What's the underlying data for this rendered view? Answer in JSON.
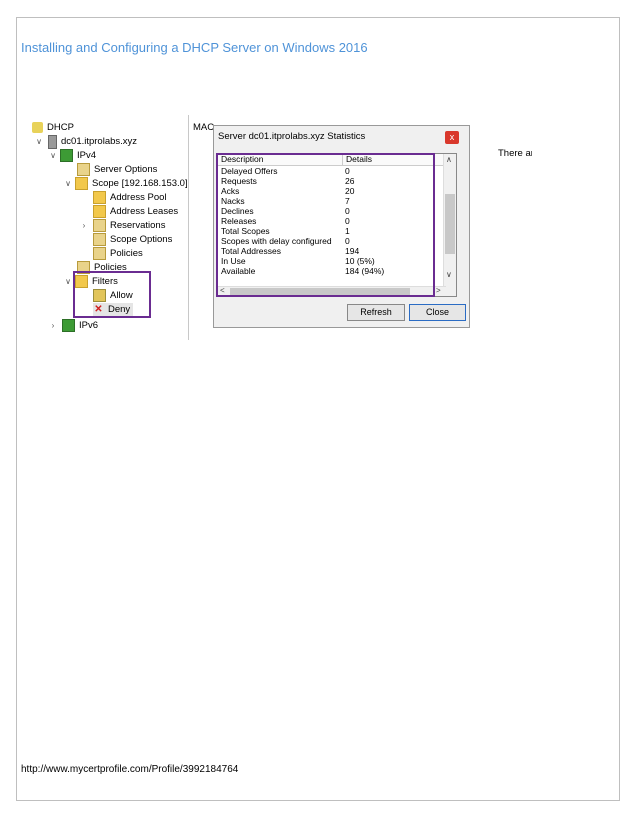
{
  "doc_title": "Installing and Configuring a DHCP Server on Windows 2016",
  "footer_url": "http://www.mycertprofile.com/Profile/3992184764",
  "tree": [
    {
      "label": "DHCP",
      "icon": "dhcp-icon"
    },
    {
      "label": "dc01.itprolabs.xyz",
      "icon": "server-icon"
    },
    {
      "label": "IPv4",
      "icon": "ipv4-icon"
    },
    {
      "label": "Server Options",
      "icon": "server-options-icon"
    },
    {
      "label": "Scope [192.168.153.0]",
      "icon": "folder-icon"
    },
    {
      "label": "Address Pool",
      "icon": "address-pool-icon"
    },
    {
      "label": "Address Leases",
      "icon": "address-leases-icon"
    },
    {
      "label": "Reservations",
      "icon": "reservations-icon"
    },
    {
      "label": "Scope Options",
      "icon": "scope-options-icon"
    },
    {
      "label": "Policies",
      "icon": "policies-icon"
    },
    {
      "label": "Policies",
      "icon": "policies-icon"
    },
    {
      "label": "Filters",
      "icon": "filters-icon"
    },
    {
      "label": "Allow",
      "icon": "allow-icon"
    },
    {
      "label": "Deny",
      "icon": "deny-icon"
    },
    {
      "label": "IPv6",
      "icon": "ipv6-icon"
    }
  ],
  "right_pane": {
    "column_label": "MAC",
    "empty_text": "There are no items"
  },
  "dialog": {
    "title": "Server dc01.itprolabs.xyz Statistics",
    "close_glyph": "x",
    "columns": [
      "Description",
      "Details"
    ],
    "rows": [
      [
        "Delayed Offers",
        "0"
      ],
      [
        "Requests",
        "26"
      ],
      [
        "Acks",
        "20"
      ],
      [
        "Nacks",
        "7"
      ],
      [
        "Declines",
        "0"
      ],
      [
        "Releases",
        "0"
      ],
      [
        "Total Scopes",
        "1"
      ],
      [
        "Scopes with delay configured",
        "0"
      ],
      [
        "Total Addresses",
        "194"
      ],
      [
        "In Use",
        "10 (5%)"
      ],
      [
        "Available",
        "184 (94%)"
      ]
    ],
    "refresh_label": "Refresh",
    "close_label": "Close"
  },
  "highlight_color": "#6a2c91",
  "title_color": "#4f93d8"
}
